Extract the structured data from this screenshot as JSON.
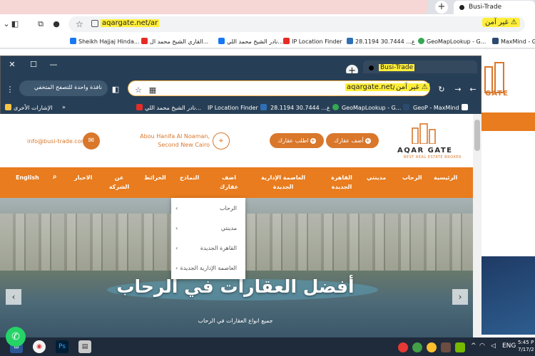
{
  "bg_browser": {
    "tab_title": "Busi-Trade",
    "url": "aqargate.net/ar",
    "insecure_label": "غير آمن",
    "bookmarks": [
      "Sheikh Hajjaj Hinda...",
      "القاري الشيخ محمد ال...",
      "نادر الشيخ محمد اللي...",
      "IP Location Finder",
      "ع... 30.7444 28.1194",
      "GeoMapLookup - G...",
      "MaxMind - G"
    ]
  },
  "fg_browser": {
    "tab_title": "Busi-Trade",
    "url": "aqargate.net/ar",
    "insecure_label": "غير آمن",
    "split_pill": "نافذة واحدة للتصفح المتخفي",
    "bookmarks": [
      "GeoP - MaxMind",
      "GeoMapLookup - G...",
      "ع... 30.7444 28.1194",
      "IP Location Finder",
      "نادر الشيخ محمد اللي...",
      "الإشارات الأخرى"
    ]
  },
  "site": {
    "logo_word": "AQAR GATE",
    "logo_sub": "BEST REAL ESTATE BROKER",
    "buttons": {
      "add_property": "أضف عقارك",
      "request_property": "اطلب عقارك"
    },
    "address": "Abou Hanifa Al Noaman, Second New Cairo",
    "email": "info@busi-trade.com",
    "nav": [
      "الرئيسية",
      "الرحاب",
      "مدينتي",
      "القاهرة الجديدة",
      "العاصمة الإدارية الجديدة",
      "اضف عقارك",
      "النماذج",
      "الخرائط",
      "عن الشركة",
      "الاخبار",
      "English"
    ],
    "dropdown": [
      "الرحاب",
      "مدينتي",
      "القاهرة الجديدة",
      "العاصمة الإدارية الجديدة"
    ],
    "hero_title": "أفضل العقارات في الرحاب",
    "hero_subtitle": "جميع انواع العقارات في الرحاب"
  },
  "taskbar": {
    "lang": "ENG",
    "time": "5:45 P",
    "date": "7/17/2"
  },
  "colors": {
    "brand_orange": "#e87c1e",
    "dark_chrome": "#273f56",
    "highlight": "#ffef3a"
  }
}
